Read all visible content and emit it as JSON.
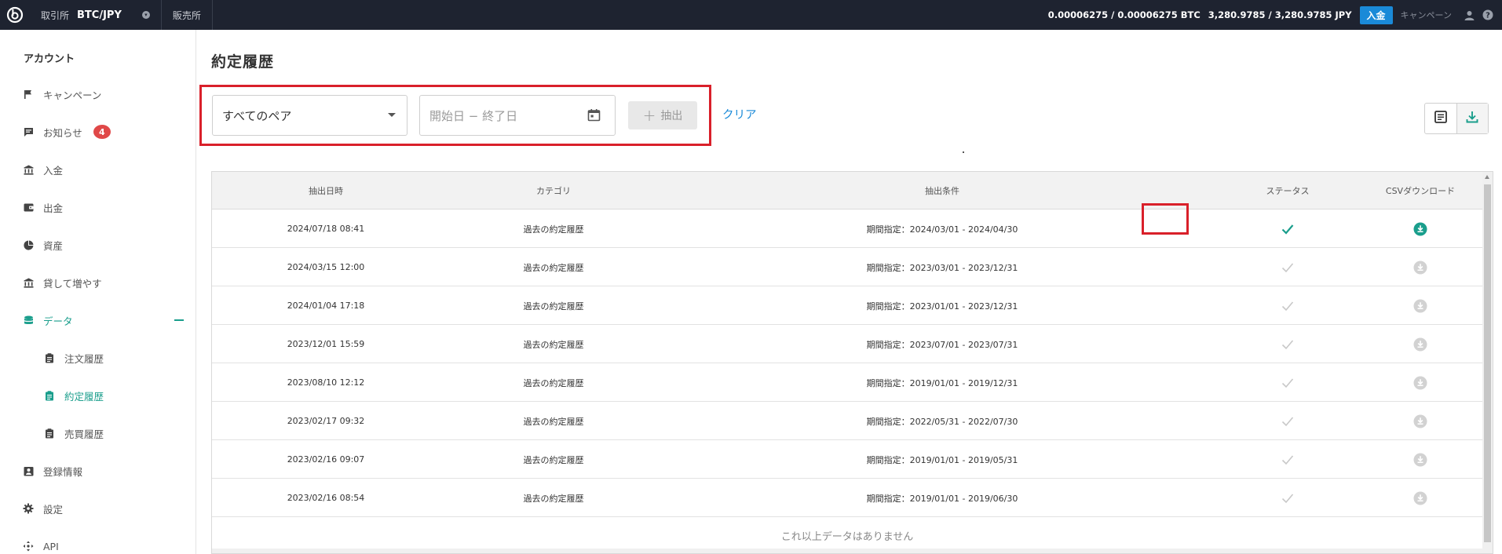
{
  "topbar": {
    "exchange_label": "取引所",
    "pair": "BTC/JPY",
    "sales_label": "販売所",
    "btc_balance": "0.00006275 / 0.00006275 BTC",
    "jpy_balance": "3,280.9785 / 3,280.9785 JPY",
    "deposit_button": "入金",
    "campaign_link": "キャンペーン"
  },
  "sidebar": {
    "title": "アカウント",
    "items": [
      {
        "label": "キャンペーン",
        "icon": "flag-icon"
      },
      {
        "label": "お知らせ",
        "icon": "message-icon",
        "badge": "4"
      },
      {
        "label": "入金",
        "icon": "bank-icon"
      },
      {
        "label": "出金",
        "icon": "wallet-icon"
      },
      {
        "label": "資産",
        "icon": "pie-chart-icon"
      },
      {
        "label": "貸して増やす",
        "icon": "bank-icon"
      },
      {
        "label": "データ",
        "icon": "database-icon",
        "active": true
      },
      {
        "label": "注文履歴",
        "icon": "clipboard-icon",
        "sub": true
      },
      {
        "label": "約定履歴",
        "icon": "clipboard-icon",
        "sub": true,
        "active": true
      },
      {
        "label": "売買履歴",
        "icon": "clipboard-icon",
        "sub": true
      },
      {
        "label": "登録情報",
        "icon": "id-card-icon"
      },
      {
        "label": "設定",
        "icon": "gear-icon"
      },
      {
        "label": "API",
        "icon": "api-icon"
      }
    ]
  },
  "main": {
    "title": "約定履歴",
    "filter": {
      "pair_select": "すべてのペア",
      "date_placeholder": "開始日 − 終了日",
      "extract_button": "抽出",
      "clear_link": "クリア"
    },
    "table": {
      "headers": [
        "抽出日時",
        "カテゴリ",
        "抽出条件",
        "ステータス",
        "CSVダウンロード"
      ],
      "rows": [
        {
          "date": "2024/07/18 08:41",
          "category": "過去の約定履歴",
          "condition": "期間指定：2024/03/01 - 2024/04/30",
          "status": "complete",
          "latest": true
        },
        {
          "date": "2024/03/15 12:00",
          "category": "過去の約定履歴",
          "condition": "期間指定：2023/03/01 - 2023/12/31",
          "status": "complete",
          "latest": false
        },
        {
          "date": "2024/01/04 17:18",
          "category": "過去の約定履歴",
          "condition": "期間指定：2023/01/01 - 2023/12/31",
          "status": "complete",
          "latest": false
        },
        {
          "date": "2023/12/01 15:59",
          "category": "過去の約定履歴",
          "condition": "期間指定：2023/07/01 - 2023/07/31",
          "status": "complete",
          "latest": false
        },
        {
          "date": "2023/08/10 12:12",
          "category": "過去の約定履歴",
          "condition": "期間指定：2019/01/01 - 2019/12/31",
          "status": "complete",
          "latest": false
        },
        {
          "date": "2023/02/17 09:32",
          "category": "過去の約定履歴",
          "condition": "期間指定：2022/05/31 - 2022/07/30",
          "status": "complete",
          "latest": false
        },
        {
          "date": "2023/02/16 09:07",
          "category": "過去の約定履歴",
          "condition": "期間指定：2019/01/01 - 2019/05/31",
          "status": "complete",
          "latest": false
        },
        {
          "date": "2023/02/16 08:54",
          "category": "過去の約定履歴",
          "condition": "期間指定：2019/01/01 - 2019/06/30",
          "status": "complete",
          "latest": false
        }
      ],
      "no_more": "これ以上データはありません"
    }
  },
  "colors": {
    "accent": "#1a9e8c",
    "brand_blue": "#1a8ad8",
    "highlight_red": "#d9202a",
    "badge_red": "#e04848",
    "topbar_bg": "#1e2330"
  }
}
